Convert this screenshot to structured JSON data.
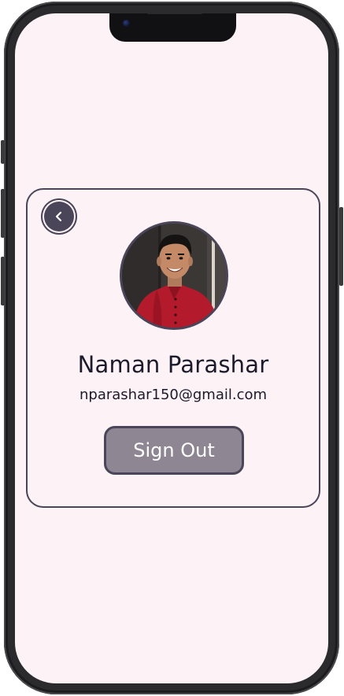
{
  "profile": {
    "name": "Naman Parashar",
    "email": "nparashar150@gmail.com"
  },
  "actions": {
    "sign_out_label": "Sign Out"
  },
  "icons": {
    "back": "chevron-left-icon",
    "avatar": "profile-photo"
  },
  "colors": {
    "screen_background": "#fdf2f6",
    "card_border": "#4a4558",
    "button_fill": "#8e8692",
    "text_primary": "#1c1b2b"
  }
}
